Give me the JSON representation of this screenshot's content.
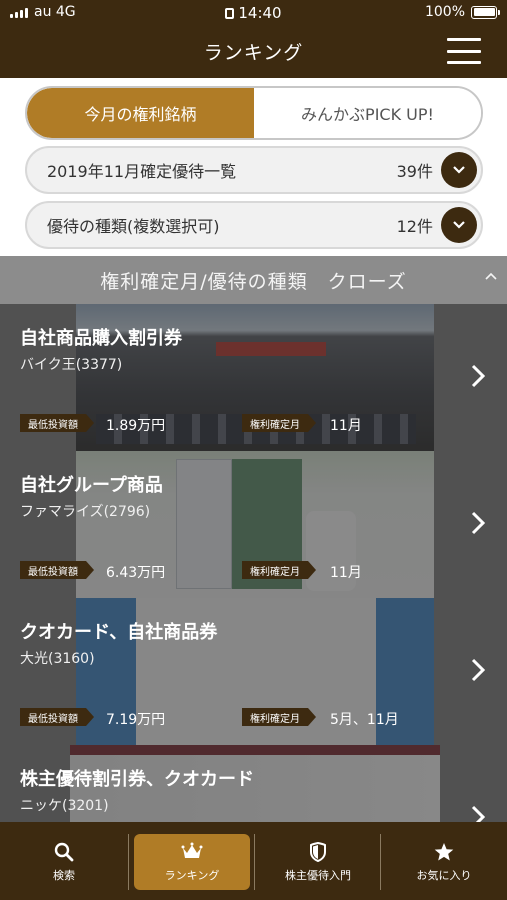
{
  "status": {
    "carrier": "au 4G",
    "time": "14:40",
    "battery": "100%"
  },
  "header": {
    "title": "ランキング"
  },
  "tabs": [
    {
      "label": "今月の権利銘柄",
      "active": true
    },
    {
      "label": "みんかぶPICK UP!",
      "active": false
    }
  ],
  "filters": [
    {
      "label": "2019年11月確定優待一覧",
      "count": "39件"
    },
    {
      "label": "優待の種類(複数選択可)",
      "count": "12件"
    }
  ],
  "collapse_bar": {
    "label": "権利確定月/優待の種類　クローズ"
  },
  "cards": [
    {
      "title": "自社商品購入割引券",
      "company": "バイク王(3377)",
      "min_invest_label": "最低投資額",
      "min_invest": "1.89万円",
      "record_month_label": "権利確定月",
      "record_month": "11月"
    },
    {
      "title": "自社グループ商品",
      "company": "ファマライズ(2796)",
      "min_invest_label": "最低投資額",
      "min_invest": "6.43万円",
      "record_month_label": "権利確定月",
      "record_month": "11月"
    },
    {
      "title": "クオカード、自社商品券",
      "company": "大光(3160)",
      "min_invest_label": "最低投資額",
      "min_invest": "7.19万円",
      "record_month_label": "権利確定月",
      "record_month": "5月、11月"
    },
    {
      "title": "株主優待割引券、クオカード",
      "company": "ニッケ(3201)"
    }
  ],
  "nav": [
    {
      "label": "検索",
      "icon": "search-icon",
      "active": false
    },
    {
      "label": "ランキング",
      "icon": "crown-icon",
      "active": true
    },
    {
      "label": "株主優待入門",
      "icon": "shield-icon",
      "active": false
    },
    {
      "label": "お気に入り",
      "icon": "star-icon",
      "active": false
    }
  ],
  "colors": {
    "brown_dark": "#3d2a10",
    "gold": "#b07c26",
    "overlay_grey": "#8c8c8c"
  }
}
